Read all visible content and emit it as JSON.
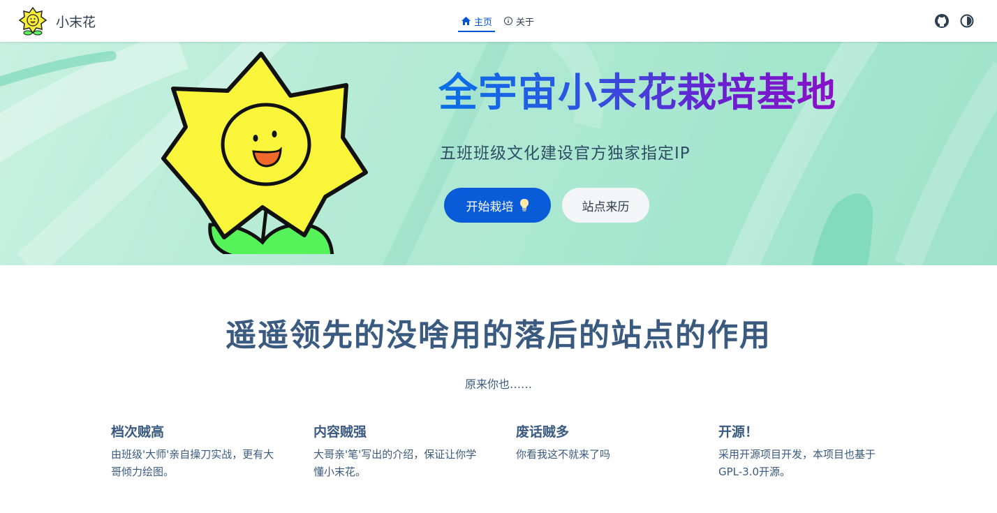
{
  "brand": {
    "name": "小末花",
    "logo_icon": "sunflower-logo-icon"
  },
  "nav": {
    "items": [
      {
        "label": "主页",
        "icon": "home-icon",
        "active": true
      },
      {
        "label": "关于",
        "icon": "info-icon",
        "active": false
      }
    ],
    "actions": [
      {
        "icon": "github-icon"
      },
      {
        "icon": "theme-toggle-icon"
      }
    ]
  },
  "hero": {
    "title": "全宇宙小末花栽培基地",
    "tagline": "五班班级文化建设官方独家指定IP",
    "primary_button": "开始栽培",
    "primary_button_icon": "lightbulb-icon",
    "secondary_button": "站点来历",
    "colors": {
      "accent": "#0a5bd8",
      "title_gradient_start": "#0a6fe8",
      "title_gradient_end": "#8a10c8",
      "hero_bg": "#b3ead6"
    }
  },
  "features_section": {
    "title": "遥遥领先的没啥用的落后的站点的作用",
    "subtitle": "原来你也……",
    "features": [
      {
        "title": "档次贼高",
        "desc": "由班级'大师'亲自操刀实战，更有大哥倾力绘图。"
      },
      {
        "title": "内容贼强",
        "desc": "大哥亲'笔'写出的介绍，保证让你学懂小末花。"
      },
      {
        "title": "废话贼多",
        "desc": "你看我这不就来了吗"
      },
      {
        "title": "开源！",
        "desc": "采用开源项目开发，本项目也基于GPL-3.0开源。"
      }
    ]
  }
}
